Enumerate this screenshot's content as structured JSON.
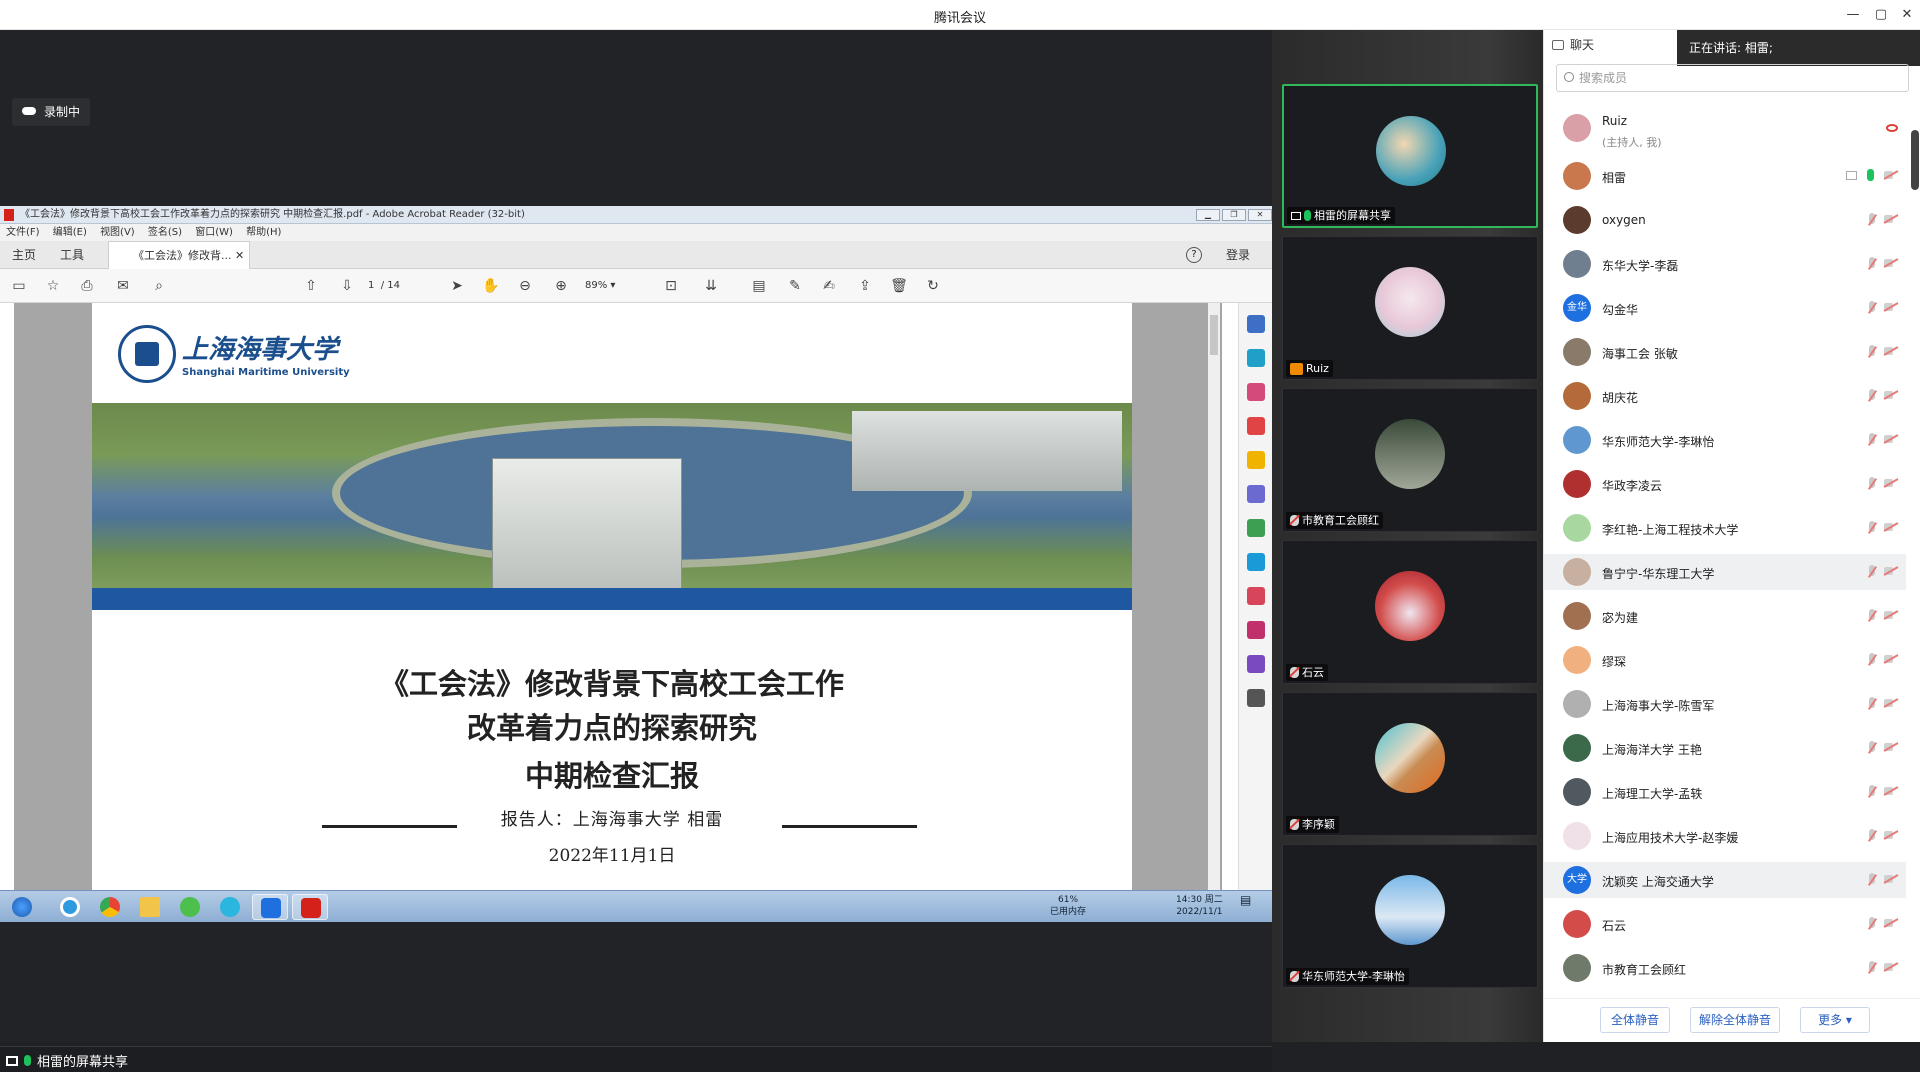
{
  "window": {
    "title": "腾讯会议",
    "min": "—",
    "max": "▢",
    "close": "✕"
  },
  "recording": {
    "label": "录制中"
  },
  "acrobat": {
    "title": "《工会法》修改背景下高校工会工作改革着力点的探索研究 中期检查汇报.pdf - Adobe Acrobat Reader (32-bit)",
    "menu": [
      "文件(F)",
      "编辑(E)",
      "视图(V)",
      "签名(S)",
      "窗口(W)",
      "帮助(H)"
    ],
    "tabs": {
      "home": "主页",
      "tools": "工具",
      "doc": "《工会法》修改背...",
      "login": "登录",
      "help": "?"
    },
    "page_current": "1",
    "page_total": "/ 14",
    "zoom": "89%"
  },
  "slide": {
    "logo_cn": "上海海事大学",
    "logo_en": "Shanghai Maritime University",
    "title_line1": "《工会法》修改背景下高校工会工作",
    "title_line2": "改革着力点的探索研究",
    "title_line3": "中期检查汇报",
    "reporter": "报告人：上海海事大学 相雷",
    "date": "2022年11月1日"
  },
  "taskbar": {
    "mem_pct": "61%",
    "mem_label": "已用内存",
    "time": "14:30 周二",
    "date": "2022/11/1"
  },
  "bottom": {
    "share_label": "相雷的屏幕共享"
  },
  "videos": [
    {
      "name": "相雷的屏幕共享",
      "active": true,
      "avatar_color": "#4aa2b8"
    },
    {
      "name": "Ruiz",
      "active": false,
      "avatar_color": "#e8c8d8"
    },
    {
      "name": "市教育工会顾红",
      "active": false,
      "avatar_color": "#6f7a6a"
    },
    {
      "name": "石云",
      "active": false,
      "avatar_color": "#d24c4a"
    },
    {
      "name": "李序颖",
      "active": false,
      "avatar_color": "#c98b52"
    },
    {
      "name": "华东师范大学-李琳怡",
      "active": false,
      "avatar_color": "#5f98d0"
    }
  ],
  "panel": {
    "tab": "聊天",
    "speaking": "正在讲话: 相雷;",
    "search_placeholder": "搜索成员",
    "participants": [
      {
        "name": "Ruiz",
        "sub": "(主持人, 我)",
        "color": "#d9a0a8",
        "initial": ""
      },
      {
        "name": "相雷",
        "sub": "",
        "color": "#c9774d",
        "initial": ""
      },
      {
        "name": "oxygen",
        "sub": "",
        "color": "#5a3b2e",
        "initial": ""
      },
      {
        "name": "东华大学-李磊",
        "sub": "",
        "color": "#6f7f8f",
        "initial": ""
      },
      {
        "name": "勾金华",
        "sub": "",
        "color": "#1e6fe0",
        "initial": "金华"
      },
      {
        "name": "海事工会 张敏",
        "sub": "",
        "color": "#8a7a6a",
        "initial": ""
      },
      {
        "name": "胡庆花",
        "sub": "",
        "color": "#b46a3a",
        "initial": ""
      },
      {
        "name": "华东师范大学-李琳怡",
        "sub": "",
        "color": "#5f98d0",
        "initial": ""
      },
      {
        "name": "华政李凌云",
        "sub": "",
        "color": "#b03030",
        "initial": ""
      },
      {
        "name": "李红艳-上海工程技术大学",
        "sub": "",
        "color": "#a8d8a0",
        "initial": ""
      },
      {
        "name": "鲁宁宁-华东理工大学",
        "sub": "",
        "color": "#c8b0a0",
        "initial": ""
      },
      {
        "name": "宓为建",
        "sub": "",
        "color": "#a07050",
        "initial": ""
      },
      {
        "name": "缪琛",
        "sub": "",
        "color": "#f0b080",
        "initial": ""
      },
      {
        "name": "上海海事大学-陈雪军",
        "sub": "",
        "color": "#b0b0b0",
        "initial": ""
      },
      {
        "name": "上海海洋大学 王艳",
        "sub": "",
        "color": "#3a6a4a",
        "initial": ""
      },
      {
        "name": "上海理工大学-孟轶",
        "sub": "",
        "color": "#505860",
        "initial": ""
      },
      {
        "name": "上海应用技术大学-赵李媛",
        "sub": "",
        "color": "#f0e0e8",
        "initial": ""
      },
      {
        "name": "沈颖奕 上海交通大学",
        "sub": "",
        "color": "#1e6fe0",
        "initial": "大学"
      },
      {
        "name": "石云",
        "sub": "",
        "color": "#d24c4a",
        "initial": ""
      },
      {
        "name": "市教育工会顾红",
        "sub": "",
        "color": "#6f7a6a",
        "initial": ""
      }
    ],
    "footer": {
      "mute_all": "全体静音",
      "unmute_all": "解除全体静音",
      "more": "更多 ▾"
    }
  }
}
